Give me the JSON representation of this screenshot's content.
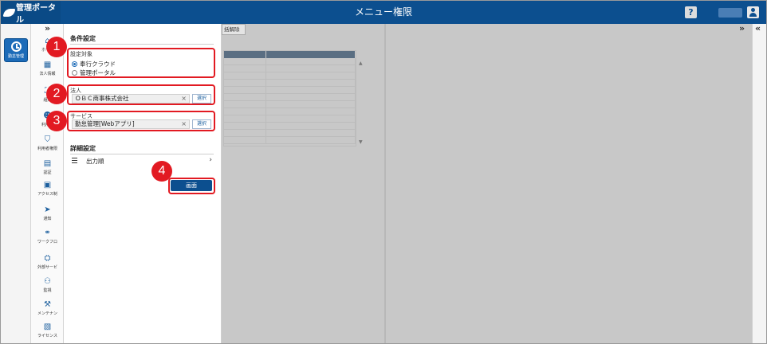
{
  "header": {
    "brand": "管理ポータル",
    "title": "メニュー権限",
    "help": "?"
  },
  "rail": {
    "kintai_label": "勤怠管理"
  },
  "menu": {
    "expand": "»",
    "items": [
      {
        "label": "ホーム",
        "icon": "home-icon",
        "glyph": "⌂"
      },
      {
        "label": "法人情報",
        "icon": "building-icon",
        "glyph": "▦"
      },
      {
        "label": "組織",
        "icon": "org-icon",
        "glyph": "⛶"
      },
      {
        "label": "利用者",
        "icon": "users-icon",
        "glyph": "☻"
      },
      {
        "label": "利用者権限",
        "icon": "shield-icon",
        "glyph": "⛉"
      },
      {
        "label": "認証",
        "icon": "id-card-icon",
        "glyph": "▤"
      },
      {
        "label": "アクセス制",
        "icon": "access-icon",
        "glyph": "▣"
      },
      {
        "label": "通知",
        "icon": "send-icon",
        "glyph": "➤"
      },
      {
        "label": "ワークフロ",
        "icon": "workflow-icon",
        "glyph": "⚭"
      },
      {
        "label": "外部サービ",
        "icon": "external-icon",
        "glyph": "⛭"
      },
      {
        "label": "監視",
        "icon": "binoculars-icon",
        "glyph": "⚇"
      },
      {
        "label": "メンテナン",
        "icon": "hammer-icon",
        "glyph": "⚒"
      },
      {
        "label": "ライセンス",
        "icon": "license-icon",
        "glyph": "▧"
      }
    ]
  },
  "panel": {
    "conditions_title": "条件設定",
    "target_label": "設定対象",
    "target_options": [
      "奉行クラウド",
      "管理ポータル"
    ],
    "target_selected": 0,
    "corp_label": "法人",
    "corp_value": "ＯＢＣ商事株式会社",
    "service_label": "サービス",
    "service_value": "勤怠管理[Webアプリ]",
    "select_btn": "選択",
    "clear": "×",
    "detail_title": "詳細設定",
    "output_order": "出力順",
    "screen_btn": "画面"
  },
  "badges": [
    "1",
    "2",
    "3",
    "4"
  ],
  "main": {
    "bulk_delete": "括解除"
  },
  "collapse": {
    "left": "»",
    "right": "«"
  }
}
